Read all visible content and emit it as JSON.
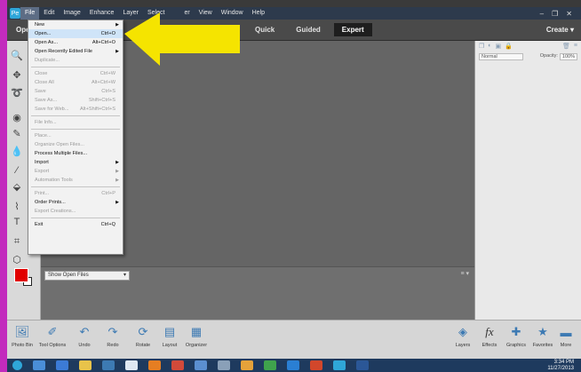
{
  "menubar": {
    "app_icon": "photoshop-elements-icon",
    "items": [
      "File",
      "Edit",
      "Image",
      "Enhance",
      "Layer",
      "Select",
      "er",
      "View",
      "Window",
      "Help"
    ],
    "window_controls": [
      "–",
      "❐",
      "✕"
    ]
  },
  "topbar": {
    "open_label": "Ope",
    "modes": [
      "Quick",
      "Guided",
      "Expert"
    ],
    "active_mode": "Expert",
    "create_label": "Create"
  },
  "file_menu": {
    "items": [
      {
        "label": "New",
        "shortcut": "",
        "submenu": true,
        "disabled": false
      },
      {
        "label": "Open...",
        "shortcut": "Ctrl+O",
        "submenu": false,
        "disabled": false,
        "highlight": true
      },
      {
        "label": "Open As...",
        "shortcut": "Alt+Ctrl+O",
        "submenu": false,
        "disabled": false
      },
      {
        "label": "Open Recently Edited File",
        "shortcut": "",
        "submenu": true,
        "disabled": false
      },
      {
        "label": "Duplicate...",
        "shortcut": "",
        "submenu": false,
        "disabled": true
      },
      {
        "sep": true
      },
      {
        "label": "Close",
        "shortcut": "Ctrl+W",
        "submenu": false,
        "disabled": true
      },
      {
        "label": "Close All",
        "shortcut": "Alt+Ctrl+W",
        "submenu": false,
        "disabled": true
      },
      {
        "label": "Save",
        "shortcut": "Ctrl+S",
        "submenu": false,
        "disabled": true
      },
      {
        "label": "Save As...",
        "shortcut": "Shift+Ctrl+S",
        "submenu": false,
        "disabled": true
      },
      {
        "label": "Save for Web...",
        "shortcut": "Alt+Shift+Ctrl+S",
        "submenu": false,
        "disabled": true
      },
      {
        "sep": true
      },
      {
        "label": "File Info...",
        "shortcut": "",
        "submenu": false,
        "disabled": true
      },
      {
        "sep": true
      },
      {
        "label": "Place...",
        "shortcut": "",
        "submenu": false,
        "disabled": true
      },
      {
        "label": "Organize Open Files...",
        "shortcut": "",
        "submenu": false,
        "disabled": true
      },
      {
        "label": "Process Multiple Files...",
        "shortcut": "",
        "submenu": false,
        "disabled": false
      },
      {
        "label": "Import",
        "shortcut": "",
        "submenu": true,
        "disabled": false
      },
      {
        "label": "Export",
        "shortcut": "",
        "submenu": true,
        "disabled": true
      },
      {
        "label": "Automation Tools",
        "shortcut": "",
        "submenu": true,
        "disabled": true
      },
      {
        "sep": true
      },
      {
        "label": "Print...",
        "shortcut": "Ctrl+P",
        "submenu": false,
        "disabled": true
      },
      {
        "label": "Order Prints...",
        "shortcut": "",
        "submenu": true,
        "disabled": false
      },
      {
        "label": "Export Creations...",
        "shortcut": "",
        "submenu": false,
        "disabled": true
      },
      {
        "sep": true
      },
      {
        "label": "Exit",
        "shortcut": "Ctrl+Q",
        "submenu": false,
        "disabled": false
      }
    ]
  },
  "bin": {
    "select_value": "Show Open Files"
  },
  "right_panel": {
    "blend_mode": "Normal",
    "opacity_label": "Opacity:",
    "opacity_value": "100%"
  },
  "bottom_left": [
    {
      "label": "Photo Bin",
      "icon": "photo-bin-icon"
    },
    {
      "label": "Tool Options",
      "icon": "tool-options-icon"
    },
    {
      "label": "Undo",
      "icon": "undo-icon"
    },
    {
      "label": "Redo",
      "icon": "redo-icon"
    },
    {
      "label": "Rotate",
      "icon": "rotate-icon"
    },
    {
      "label": "Layout",
      "icon": "layout-icon"
    },
    {
      "label": "Organizer",
      "icon": "organizer-icon"
    }
  ],
  "bottom_right": [
    {
      "label": "Layers",
      "icon": "layers-icon"
    },
    {
      "label": "Effects",
      "icon": "effects-icon"
    },
    {
      "label": "Graphics",
      "icon": "graphics-icon"
    },
    {
      "label": "Favorites",
      "icon": "favorites-icon"
    },
    {
      "label": "More",
      "icon": "more-icon"
    }
  ],
  "taskbar": {
    "time": "3:34 PM",
    "date": "11/27/2013"
  },
  "colors": {
    "foreground": "#e10000",
    "background": "#ffffff",
    "arrow": "#f5e400",
    "accent_strip": "#c22bbd"
  }
}
